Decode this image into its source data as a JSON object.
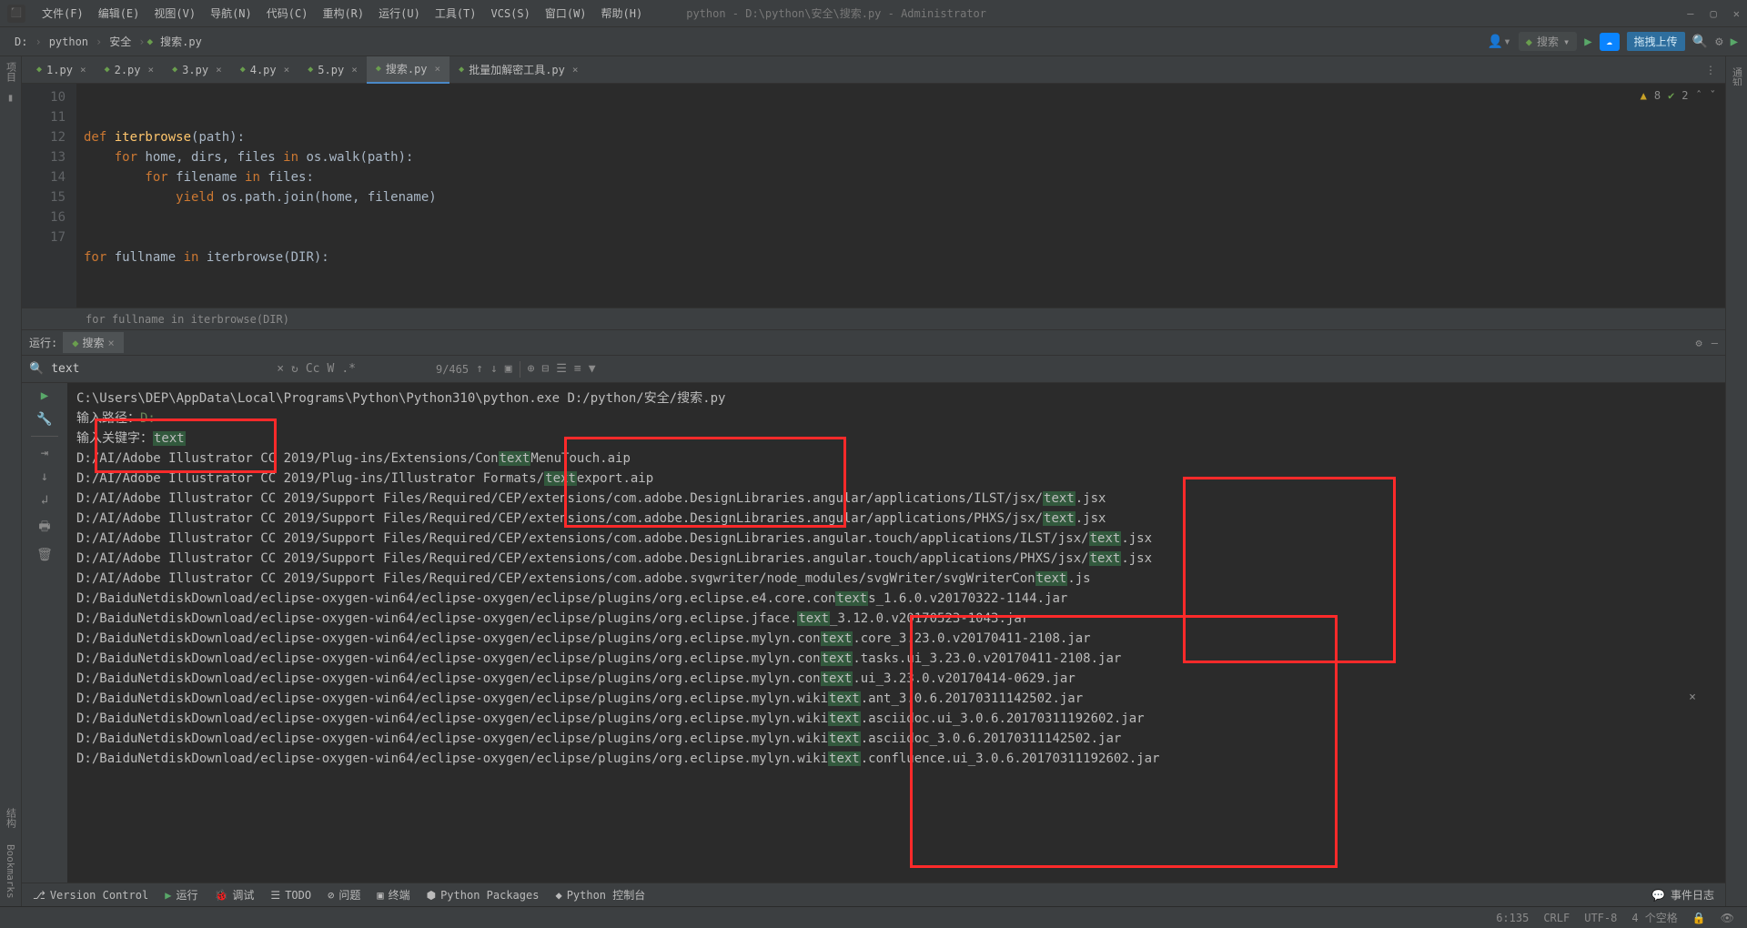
{
  "menu": {
    "items": [
      "文件(F)",
      "编辑(E)",
      "视图(V)",
      "导航(N)",
      "代码(C)",
      "重构(R)",
      "运行(U)",
      "工具(T)",
      "VCS(S)",
      "窗口(W)",
      "帮助(H)"
    ],
    "title": "python - D:\\python\\安全\\搜索.py - Administrator"
  },
  "crumbs": [
    "D:",
    "python",
    "安全",
    "搜索.py"
  ],
  "search_pill": "搜索",
  "upload": "拖拽上传",
  "tabs": [
    {
      "label": "1.py"
    },
    {
      "label": "2.py"
    },
    {
      "label": "3.py"
    },
    {
      "label": "4.py"
    },
    {
      "label": "5.py"
    },
    {
      "label": "搜索.py",
      "active": true
    },
    {
      "label": "批量加解密工具.py"
    }
  ],
  "inspect": {
    "warn": "8",
    "ok": "2"
  },
  "gutter": [
    "10",
    "11",
    "12",
    "13",
    "14",
    "15",
    "16",
    "17"
  ],
  "code": {
    "l11a": "def ",
    "l11b": "iterbrowse",
    "l11c": "(path):",
    "l12a": "    for ",
    "l12b": "home, dirs, files ",
    "l12c": "in ",
    "l12d": "os.walk(path):",
    "l13a": "        for ",
    "l13b": "filename ",
    "l13c": "in ",
    "l13d": "files:",
    "l14a": "            yield ",
    "l14b": "os.path.join(home, filename)",
    "l17a": "for ",
    "l17b": "fullname ",
    "l17c": "in ",
    "l17d": "iterbrowse(DIR):"
  },
  "breadcrumb2": "for fullname in iterbrowse(DIR)",
  "run": {
    "label": "运行:",
    "tab": "搜索"
  },
  "find": {
    "value": "text",
    "count": "9/465",
    "opts": [
      "Cc",
      "W",
      ".*"
    ]
  },
  "console": {
    "cmd": "C:\\Users\\DEP\\AppData\\Local\\Programs\\Python\\Python310\\python.exe D:/python/安全/搜索.py",
    "p1": "输入路径：",
    "p1v": "D:",
    "p2": "输入关键字：",
    "p2v": "text",
    "lines": [
      {
        "pre": "D:/AI/Adobe Illustrator CC 2019/Plug-ins/Extensions/Con",
        "hl": "text",
        "post": "MenuTouch.aip"
      },
      {
        "pre": "D:/AI/Adobe Illustrator CC 2019/Plug-ins/Illustrator Formats/",
        "hl": "text",
        "post": "export.aip"
      },
      {
        "pre": "D:/AI/Adobe Illustrator CC 2019/Support Files/Required/CEP/extensions/com.adobe.DesignLibraries.angular/applications/ILST/jsx/",
        "hl": "text",
        "post": ".jsx"
      },
      {
        "pre": "D:/AI/Adobe Illustrator CC 2019/Support Files/Required/CEP/extensions/com.adobe.DesignLibraries.angular/applications/PHXS/jsx/",
        "hl": "text",
        "post": ".jsx"
      },
      {
        "pre": "D:/AI/Adobe Illustrator CC 2019/Support Files/Required/CEP/extensions/com.adobe.DesignLibraries.angular.touch/applications/ILST/jsx/",
        "hl": "text",
        "post": ".jsx"
      },
      {
        "pre": "D:/AI/Adobe Illustrator CC 2019/Support Files/Required/CEP/extensions/com.adobe.DesignLibraries.angular.touch/applications/PHXS/jsx/",
        "hl": "text",
        "post": ".jsx"
      },
      {
        "pre": "D:/AI/Adobe Illustrator CC 2019/Support Files/Required/CEP/extensions/com.adobe.svgwriter/node_modules/svgWriter/svgWriterCon",
        "hl": "text",
        "post": ".js"
      },
      {
        "pre": "D:/BaiduNetdiskDownload/eclipse-oxygen-win64/eclipse-oxygen/eclipse/plugins/org.eclipse.e4.core.con",
        "hl": "text",
        "post": "s_1.6.0.v20170322-1144.jar"
      },
      {
        "pre": "D:/BaiduNetdiskDownload/eclipse-oxygen-win64/eclipse-oxygen/eclipse/plugins/org.eclipse.jface.",
        "hl": "text",
        "post": "_3.12.0.v20170523-1043.jar"
      },
      {
        "pre": "D:/BaiduNetdiskDownload/eclipse-oxygen-win64/eclipse-oxygen/eclipse/plugins/org.eclipse.mylyn.con",
        "hl": "text",
        "post": ".core_3.23.0.v20170411-2108.jar"
      },
      {
        "pre": "D:/BaiduNetdiskDownload/eclipse-oxygen-win64/eclipse-oxygen/eclipse/plugins/org.eclipse.mylyn.con",
        "hl": "text",
        "post": ".tasks.ui_3.23.0.v20170411-2108.jar"
      },
      {
        "pre": "D:/BaiduNetdiskDownload/eclipse-oxygen-win64/eclipse-oxygen/eclipse/plugins/org.eclipse.mylyn.con",
        "hl": "text",
        "post": ".ui_3.23.0.v20170414-0629.jar"
      },
      {
        "pre": "D:/BaiduNetdiskDownload/eclipse-oxygen-win64/eclipse-oxygen/eclipse/plugins/org.eclipse.mylyn.wiki",
        "hl": "text",
        "post": ".ant_3.0.6.20170311142502.jar"
      },
      {
        "pre": "D:/BaiduNetdiskDownload/eclipse-oxygen-win64/eclipse-oxygen/eclipse/plugins/org.eclipse.mylyn.wiki",
        "hl": "text",
        "post": ".asciidoc.ui_3.0.6.20170311192602.jar"
      },
      {
        "pre": "D:/BaiduNetdiskDownload/eclipse-oxygen-win64/eclipse-oxygen/eclipse/plugins/org.eclipse.mylyn.wiki",
        "hl": "text",
        "post": ".asciidoc_3.0.6.20170311142502.jar"
      },
      {
        "pre": "D:/BaiduNetdiskDownload/eclipse-oxygen-win64/eclipse-oxygen/eclipse/plugins/org.eclipse.mylyn.wiki",
        "hl": "text",
        "post": ".confluence.ui_3.0.6.20170311192602.jar"
      }
    ]
  },
  "bottom": [
    "Version Control",
    "运行",
    "调试",
    "TODO",
    "问题",
    "终端",
    "Python Packages",
    "Python 控制台"
  ],
  "eventlog": "事件日志",
  "status": {
    "pos": "6:135",
    "eol": "CRLF",
    "enc": "UTF-8",
    "indent": "4 个空格"
  }
}
